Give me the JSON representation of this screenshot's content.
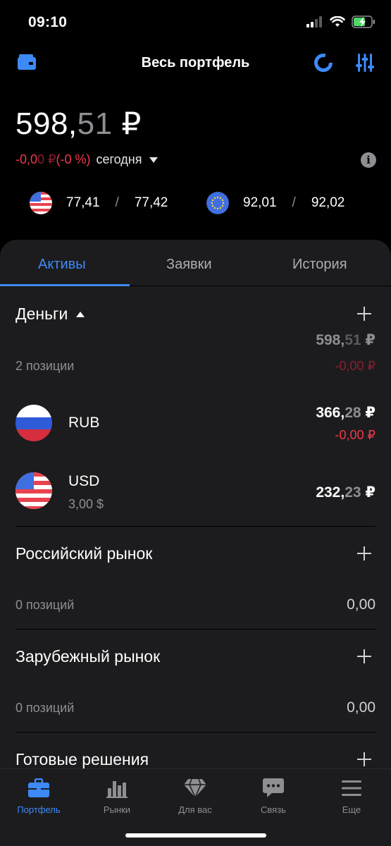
{
  "status": {
    "time": "09:10"
  },
  "header": {
    "title": "Весь портфель"
  },
  "balance": {
    "int": "598,",
    "frac": "51",
    "currency": " ₽"
  },
  "change": {
    "amount_main": "-0,0",
    "amount_dim": "0 ₽",
    "percent": " (-0 %)",
    "period": "сегодня"
  },
  "rates": [
    {
      "flag": "us-flag-icon",
      "buy": "77,41",
      "sep": "/",
      "sell": "77,42"
    },
    {
      "flag": "eu-flag-icon",
      "buy": "92,01",
      "sep": "/",
      "sell": "92,02"
    }
  ],
  "tabs": [
    {
      "label": "Активы",
      "active": true
    },
    {
      "label": "Заявки",
      "active": false
    },
    {
      "label": "История",
      "active": false
    }
  ],
  "money": {
    "title": "Деньги",
    "total_int": "598,",
    "total_frac": "51",
    "total_cur": " ₽",
    "positions": "2 позиции",
    "change": "-0,00 ₽",
    "items": [
      {
        "code": "RUB",
        "amount_int": "366,",
        "amount_frac": "28",
        "amount_cur": " ₽",
        "change": "-0,00 ₽"
      },
      {
        "code": "USD",
        "sub": "3,00 $",
        "amount_int": "232,",
        "amount_frac": "23",
        "amount_cur": " ₽"
      }
    ]
  },
  "russian_market": {
    "title": "Российский рынок",
    "positions": "0 позиций",
    "value": "0,00"
  },
  "foreign_market": {
    "title": "Зарубежный рынок",
    "positions": "0 позиций",
    "value": "0,00"
  },
  "ready_solutions": {
    "title": "Готовые решения"
  },
  "tabbar": [
    {
      "label": "Портфель",
      "icon": "briefcase-icon",
      "active": true
    },
    {
      "label": "Рынки",
      "icon": "bar-chart-icon",
      "active": false
    },
    {
      "label": "Для вас",
      "icon": "diamond-icon",
      "active": false
    },
    {
      "label": "Связь",
      "icon": "chat-icon",
      "active": false
    },
    {
      "label": "Еще",
      "icon": "menu-icon",
      "active": false
    }
  ],
  "colors": {
    "accent": "#3d8af7",
    "negative": "#f0384b",
    "sheet": "#1c1c1e",
    "background": "#000000"
  }
}
